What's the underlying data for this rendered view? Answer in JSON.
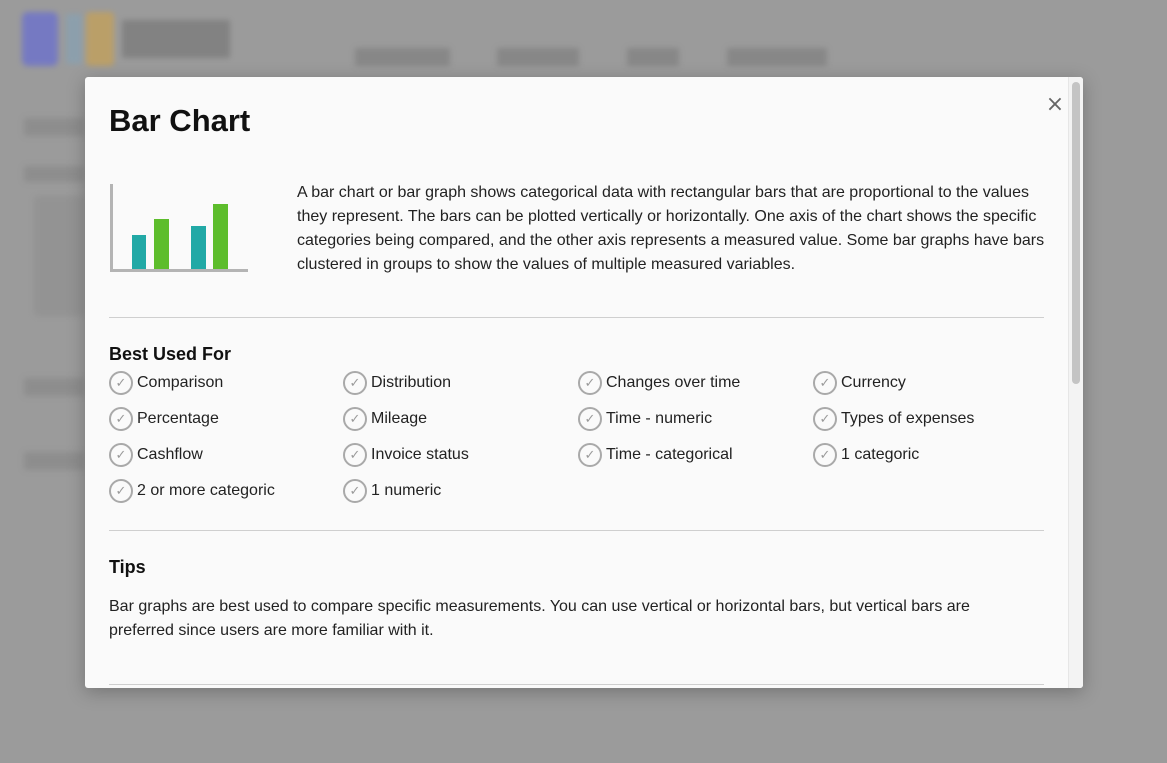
{
  "modal": {
    "title": "Bar Chart",
    "close_label": "×",
    "description": "A bar chart or bar graph shows categorical data with rectangular bars that are proportional to the values they represent. The bars can be plotted vertically or horizontally. One axis of the chart shows the specific categories being compared, and the other axis represents a measured value. Some bar graphs have bars clustered in groups to show the values of multiple measured variables.",
    "best_used_for": {
      "heading": "Best Used For",
      "items": [
        "Comparison",
        "Distribution",
        "Changes over time",
        "Currency",
        "Percentage",
        "Mileage",
        "Time - numeric",
        "Types of expenses",
        "Cashflow",
        "Invoice status",
        "Time - categorical",
        "1 categoric",
        "2 or more categoric",
        "1 numeric"
      ]
    },
    "tips": {
      "heading": "Tips",
      "text": "Bar graphs are best used to compare specific measurements. You can use vertical or horizontal bars, but vertical bars are preferred since users are more familiar with it."
    },
    "icon": {
      "name": "bar-chart-icon",
      "colors": {
        "teal": "#22a9a6",
        "green": "#5dbd2c",
        "axis": "#b4b4b4"
      }
    }
  },
  "colors": {
    "overlay": "#9b9b9b",
    "modal_bg": "#fafafa",
    "text": "#222222",
    "divider": "#cfcfcf",
    "check": "#a9a9a9"
  }
}
